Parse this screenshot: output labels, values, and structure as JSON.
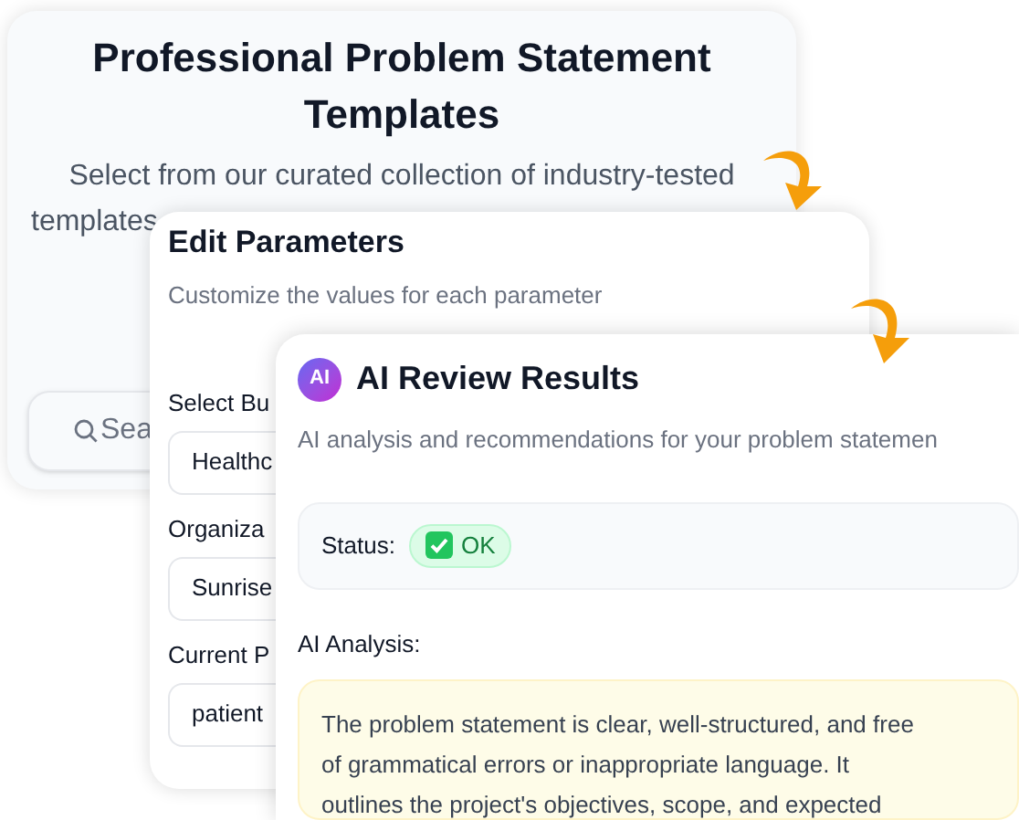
{
  "templates_card": {
    "title": "Professional Problem Statement Templates",
    "description_lines": [
      "Select from our curated collection of industry-tested",
      "templates"
    ],
    "search": {
      "placeholder": "Sea"
    }
  },
  "edit_parameters": {
    "title": "Edit Parameters",
    "subtitle": "Customize the values for each parameter",
    "fields": [
      {
        "label": "Select Bu",
        "value": "Healthc"
      },
      {
        "label": "Organiza",
        "value": "Sunrise"
      },
      {
        "label": "Current P",
        "value": "patient"
      }
    ]
  },
  "ai_review": {
    "badge": "AI",
    "title": "AI Review Results",
    "subtitle": "AI analysis and recommendations for your problem statemen",
    "status": {
      "label": "Status:",
      "value": "OK",
      "kind": "ok"
    },
    "analysis_label": "AI Analysis:",
    "analysis_lines": [
      "The problem statement is clear, well-structured, and free",
      "of grammatical errors or inappropriate language. It",
      "outlines the project's objectives, scope, and expected"
    ]
  }
}
